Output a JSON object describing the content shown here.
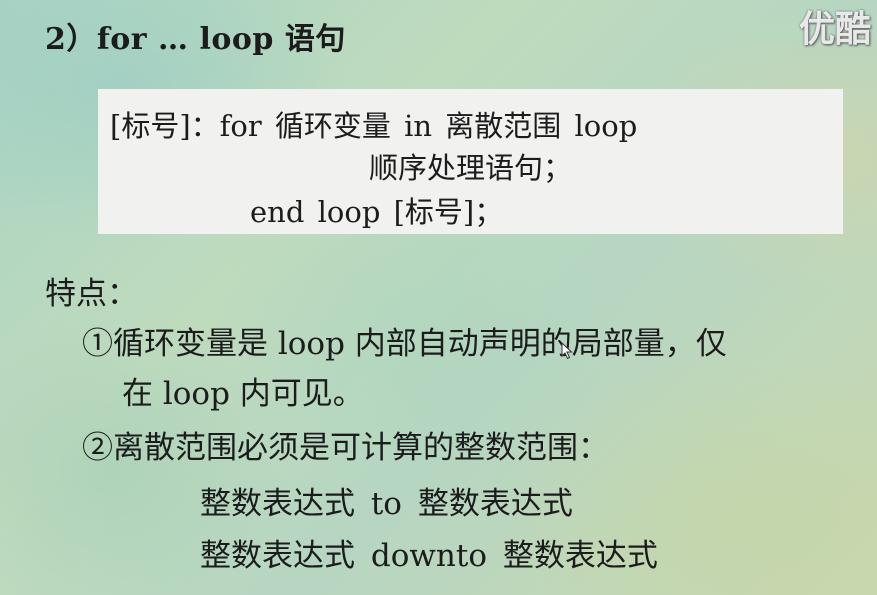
{
  "heading": "2）for … loop 语句",
  "watermark": "优酷",
  "syntax": {
    "line1": "[标号]：for 循环变量  in  离散范围   loop",
    "line2": "顺序处理语句；",
    "line3": "end  loop [标号]；"
  },
  "features": {
    "title": "特点：",
    "item1_line1": "①循环变量是 loop 内部自动声明的局部量，仅",
    "item1_line2": "在 loop 内可见。",
    "item2": "②离散范围必须是可计算的整数范围：",
    "range1": "整数表达式   to   整数表达式",
    "range2": "整数表达式   downto   整数表达式"
  }
}
